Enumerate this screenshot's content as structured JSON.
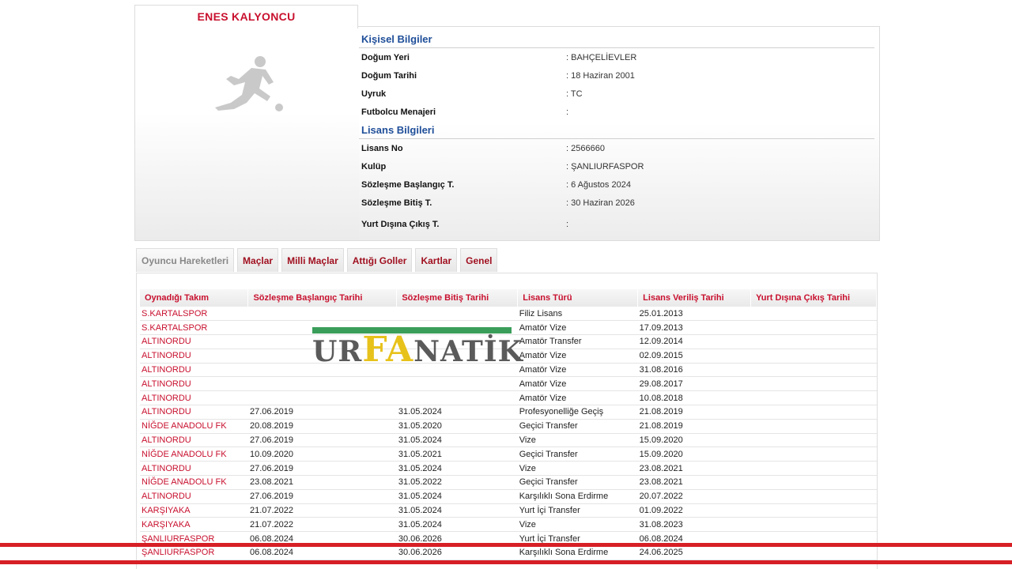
{
  "player": {
    "name": "ENES KALYONCU",
    "photo_icon": "player-silhouette-icon"
  },
  "personal": {
    "title": "Kişisel Bilgiler",
    "rows": [
      {
        "label": "Doğum Yeri",
        "value": ":  BAHÇELİEVLER"
      },
      {
        "label": "Doğum Tarihi",
        "value": ":  18 Haziran 2001"
      },
      {
        "label": "Uyruk",
        "value": ":  TC"
      },
      {
        "label": "Futbolcu Menajeri",
        "value": ":"
      }
    ]
  },
  "license": {
    "title": "Lisans Bilgileri",
    "rows": [
      {
        "label": "Lisans No",
        "value": ": 2566660"
      },
      {
        "label": "Kulüp",
        "value": ": ŞANLIURFASPOR"
      },
      {
        "label": "Sözleşme Başlangıç T.",
        "value": ": 6 Ağustos 2024"
      },
      {
        "label": "Sözleşme Bitiş T.",
        "value": ": 30 Haziran 2026"
      },
      {
        "label": "Yurt Dışına Çıkış T.",
        "value": ":"
      }
    ]
  },
  "tabs": [
    {
      "label": "Oyuncu Hareketleri",
      "active": true
    },
    {
      "label": "Maçlar",
      "active": false
    },
    {
      "label": "Milli Maçlar",
      "active": false
    },
    {
      "label": "Attığı Goller",
      "active": false
    },
    {
      "label": "Kartlar",
      "active": false
    },
    {
      "label": "Genel",
      "active": false
    }
  ],
  "table": {
    "columns": [
      "Oynadığı Takım",
      "Sözleşme Başlangıç Tarihi",
      "Sözleşme Bitiş Tarihi",
      "Lisans Türü",
      "Lisans Veriliş Tarihi",
      "Yurt Dışına Çıkış Tarihi"
    ],
    "rows": [
      [
        "S.KARTALSPOR",
        "",
        "",
        "Filiz Lisans",
        "25.01.2013",
        ""
      ],
      [
        "S.KARTALSPOR",
        "",
        "",
        "Amatör Vize",
        "17.09.2013",
        ""
      ],
      [
        "ALTINORDU",
        "",
        "",
        "Amatör Transfer",
        "12.09.2014",
        ""
      ],
      [
        "ALTINORDU",
        "",
        "",
        "Amatör Vize",
        "02.09.2015",
        ""
      ],
      [
        "ALTINORDU",
        "",
        "",
        "Amatör Vize",
        "31.08.2016",
        ""
      ],
      [
        "ALTINORDU",
        "",
        "",
        "Amatör Vize",
        "29.08.2017",
        ""
      ],
      [
        "ALTINORDU",
        "",
        "",
        "Amatör Vize",
        "10.08.2018",
        ""
      ],
      [
        "ALTINORDU",
        "27.06.2019",
        "31.05.2024",
        "Profesyonelliğe Geçiş",
        "21.08.2019",
        ""
      ],
      [
        "NİĞDE ANADOLU FK",
        "20.08.2019",
        "31.05.2020",
        "Geçici Transfer",
        "21.08.2019",
        ""
      ],
      [
        "ALTINORDU",
        "27.06.2019",
        "31.05.2024",
        "Vize",
        "15.09.2020",
        ""
      ],
      [
        "NİĞDE ANADOLU FK",
        "10.09.2020",
        "31.05.2021",
        "Geçici Transfer",
        "15.09.2020",
        ""
      ],
      [
        "ALTINORDU",
        "27.06.2019",
        "31.05.2024",
        "Vize",
        "23.08.2021",
        ""
      ],
      [
        "NİĞDE ANADOLU FK",
        "23.08.2021",
        "31.05.2022",
        "Geçici Transfer",
        "23.08.2021",
        ""
      ],
      [
        "ALTINORDU",
        "27.06.2019",
        "31.05.2024",
        "Karşılıklı Sona Erdirme",
        "20.07.2022",
        ""
      ],
      [
        "KARŞIYAKA",
        "21.07.2022",
        "31.05.2024",
        "Yurt İçi Transfer",
        "01.09.2022",
        ""
      ],
      [
        "KARŞIYAKA",
        "21.07.2022",
        "31.05.2024",
        "Vize",
        "31.08.2023",
        ""
      ],
      [
        "ŞANLIURFASPOR",
        "06.08.2024",
        "30.06.2026",
        "Yurt İçi Transfer",
        "06.08.2024",
        ""
      ],
      [
        "ŞANLIURFASPOR",
        "06.08.2024",
        "30.06.2026",
        "Karşılıklı Sona Erdirme",
        "24.06.2025",
        ""
      ]
    ]
  },
  "watermark": {
    "part1": "UR",
    "part2": "FA",
    "part3": "NATİK",
    "bar_color": "#3a9e5a",
    "gold_color": "#e7c21b"
  },
  "colors": {
    "accent_red": "#c8102e",
    "section_blue": "#1f4e99",
    "highlight_red": "#d71f26"
  }
}
